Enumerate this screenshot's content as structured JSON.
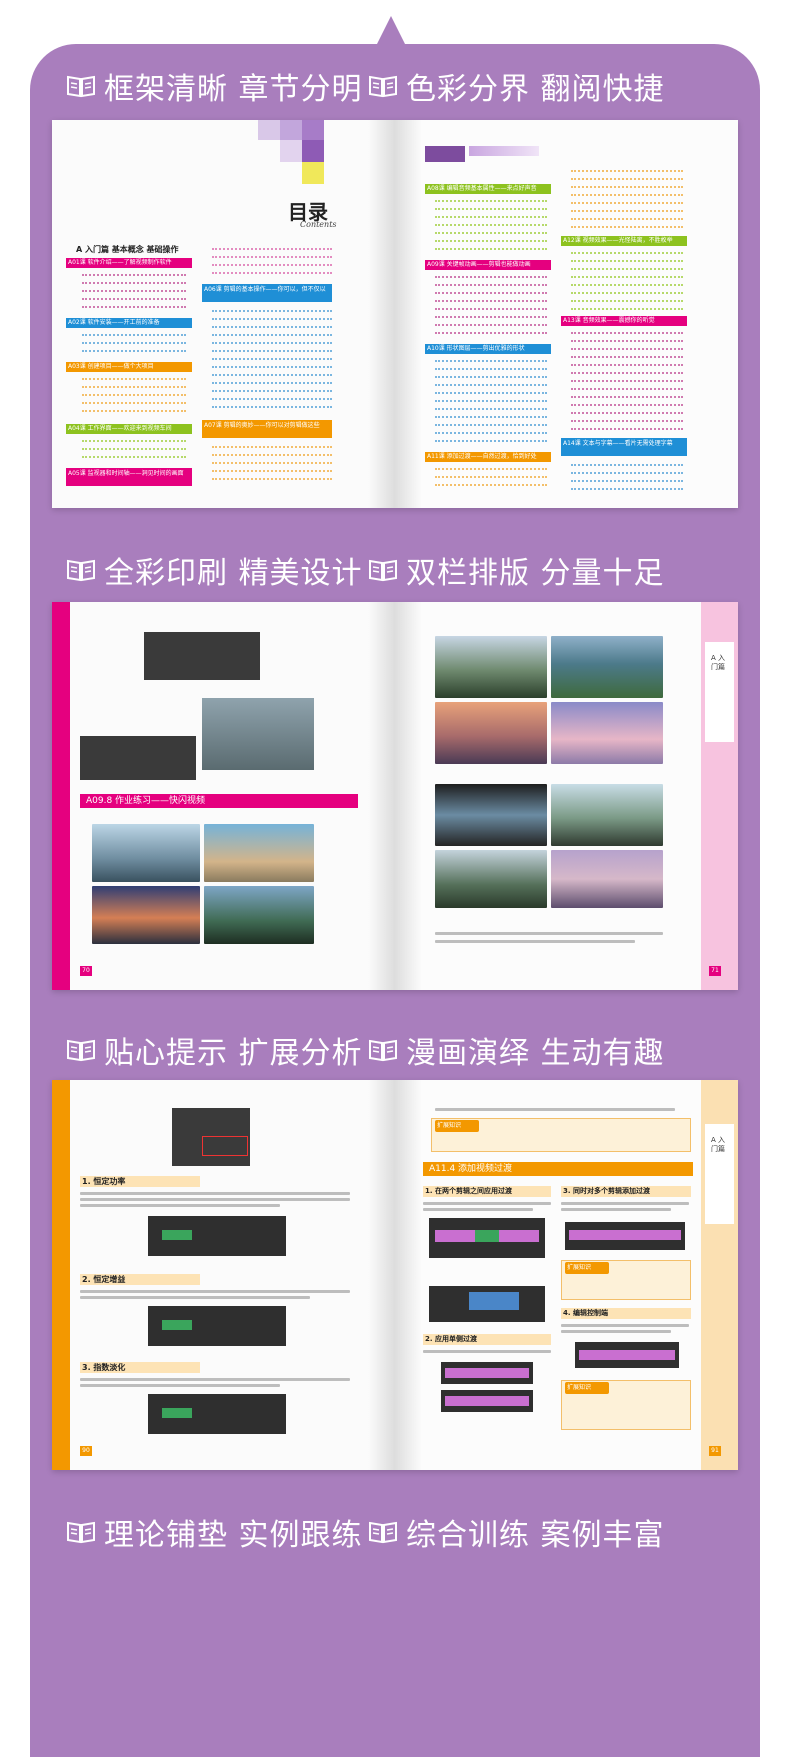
{
  "captions": {
    "c1": "框架清晰 章节分明",
    "c2": "色彩分界 翻阅快捷",
    "c3": "全彩印刷 精美设计",
    "c4": "双栏排版 分量十足",
    "c5": "贴心提示 扩展分析",
    "c6": "漫画演绎 生动有趣",
    "c7": "理论铺垫 实例跟练",
    "c8": "综合训练 案例丰富"
  },
  "icons": {
    "caption": "open-book-icon"
  },
  "spread1": {
    "toc_title": "目录",
    "toc_subtitle": "Contents",
    "part_heading": "A  入门篇  基本概念  基础操作",
    "left_lessons": [
      "A01课  软件介绍——了解视频制作软件",
      "A02课  软件安装——开工前的准备",
      "A03课  创建项目——做个大项目",
      "A04课  工作界面——欢迎来到视频车间",
      "A05课  监视器和时间轴——洞见时间的画面"
    ],
    "left_col2_lessons": [
      "A06课  剪辑的基本操作——你可以，但不仅以",
      "A07课  剪辑的奥妙——你可以对剪辑做这些"
    ],
    "right_lessons": [
      "A08课  编辑音频基本属性——来点好声音",
      "A09课  关键帧动画——剪辑也能做动画",
      "A10课  形状图层——剪出优雅的形状",
      "A11课  添加过渡——自然过渡，恰到好处"
    ],
    "right_col2_lessons": [
      "A12课  视频效果——光怪陆离，不胜枚举",
      "A13课  音频效果——震撼你的听觉",
      "A14课  文本与字幕——看片无需处理字幕"
    ]
  },
  "spread2": {
    "section_heading": "A09.8  作业练习——快闪视频",
    "side_tab": "A 入门篇",
    "left_page_no": "70",
    "right_page_no": "71"
  },
  "spread3": {
    "section_heading": "A11.4  添加视频过渡",
    "sub1": "1. 恒定功率",
    "sub2": "2. 恒定增益",
    "sub3": "3. 指数淡化",
    "r_sub1": "1. 在两个剪辑之间应用过渡",
    "r_sub2": "2. 应用单侧过渡",
    "r_sub3": "3. 同时对多个剪辑添加过渡",
    "r_sub4": "4. 编辑控制端",
    "tip1": "扩展知识",
    "tip2": "扩展知识",
    "tip3": "扩展知识",
    "side_tab": "A 入门篇",
    "left_page_no": "90",
    "right_page_no": "91"
  },
  "colors": {
    "panel": "#a97ebd",
    "magenta": "#e5007f",
    "blue": "#1f8fd6",
    "orange": "#f39800",
    "green": "#8dc21f",
    "purple": "#7d4c9e"
  }
}
